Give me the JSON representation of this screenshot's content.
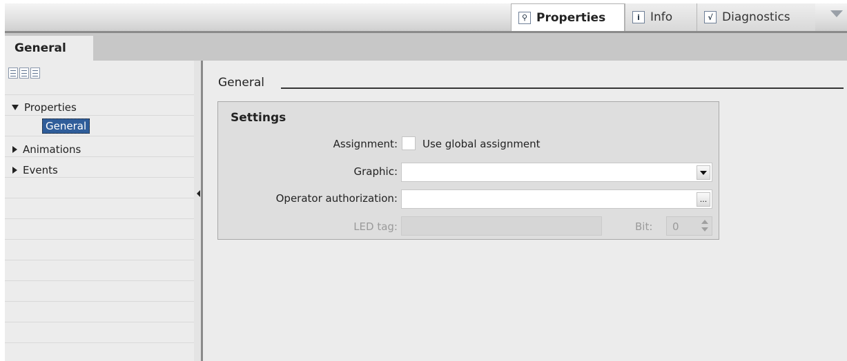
{
  "top_tabs": [
    {
      "label": "Properties",
      "icon": "properties-icon",
      "active": true
    },
    {
      "label": "Info",
      "icon": "info-icon",
      "active": false
    },
    {
      "label": "Diagnostics",
      "icon": "diagnostics-icon",
      "active": false
    }
  ],
  "subtab": {
    "label": "General"
  },
  "nav": {
    "tree": [
      {
        "label": "Properties",
        "expanded": true,
        "children": [
          {
            "label": "General",
            "selected": true
          }
        ]
      },
      {
        "label": "Animations",
        "expanded": false
      },
      {
        "label": "Events",
        "expanded": false
      }
    ]
  },
  "section": {
    "title": "General"
  },
  "settings": {
    "title": "Settings",
    "assignment": {
      "label": "Assignment:",
      "checkbox_text": "Use global assignment",
      "checked": false
    },
    "graphic": {
      "label": "Graphic:",
      "value": ""
    },
    "operator_authorization": {
      "label": "Operator authorization:",
      "value": "",
      "button": "..."
    },
    "led_tag": {
      "label": "LED tag:",
      "value": "",
      "enabled": false
    },
    "bit": {
      "label": "Bit:",
      "value": "0",
      "enabled": false
    }
  },
  "colors": {
    "selection": "#2f5d9a",
    "panel": "#ececec",
    "group_box": "#dedede"
  }
}
